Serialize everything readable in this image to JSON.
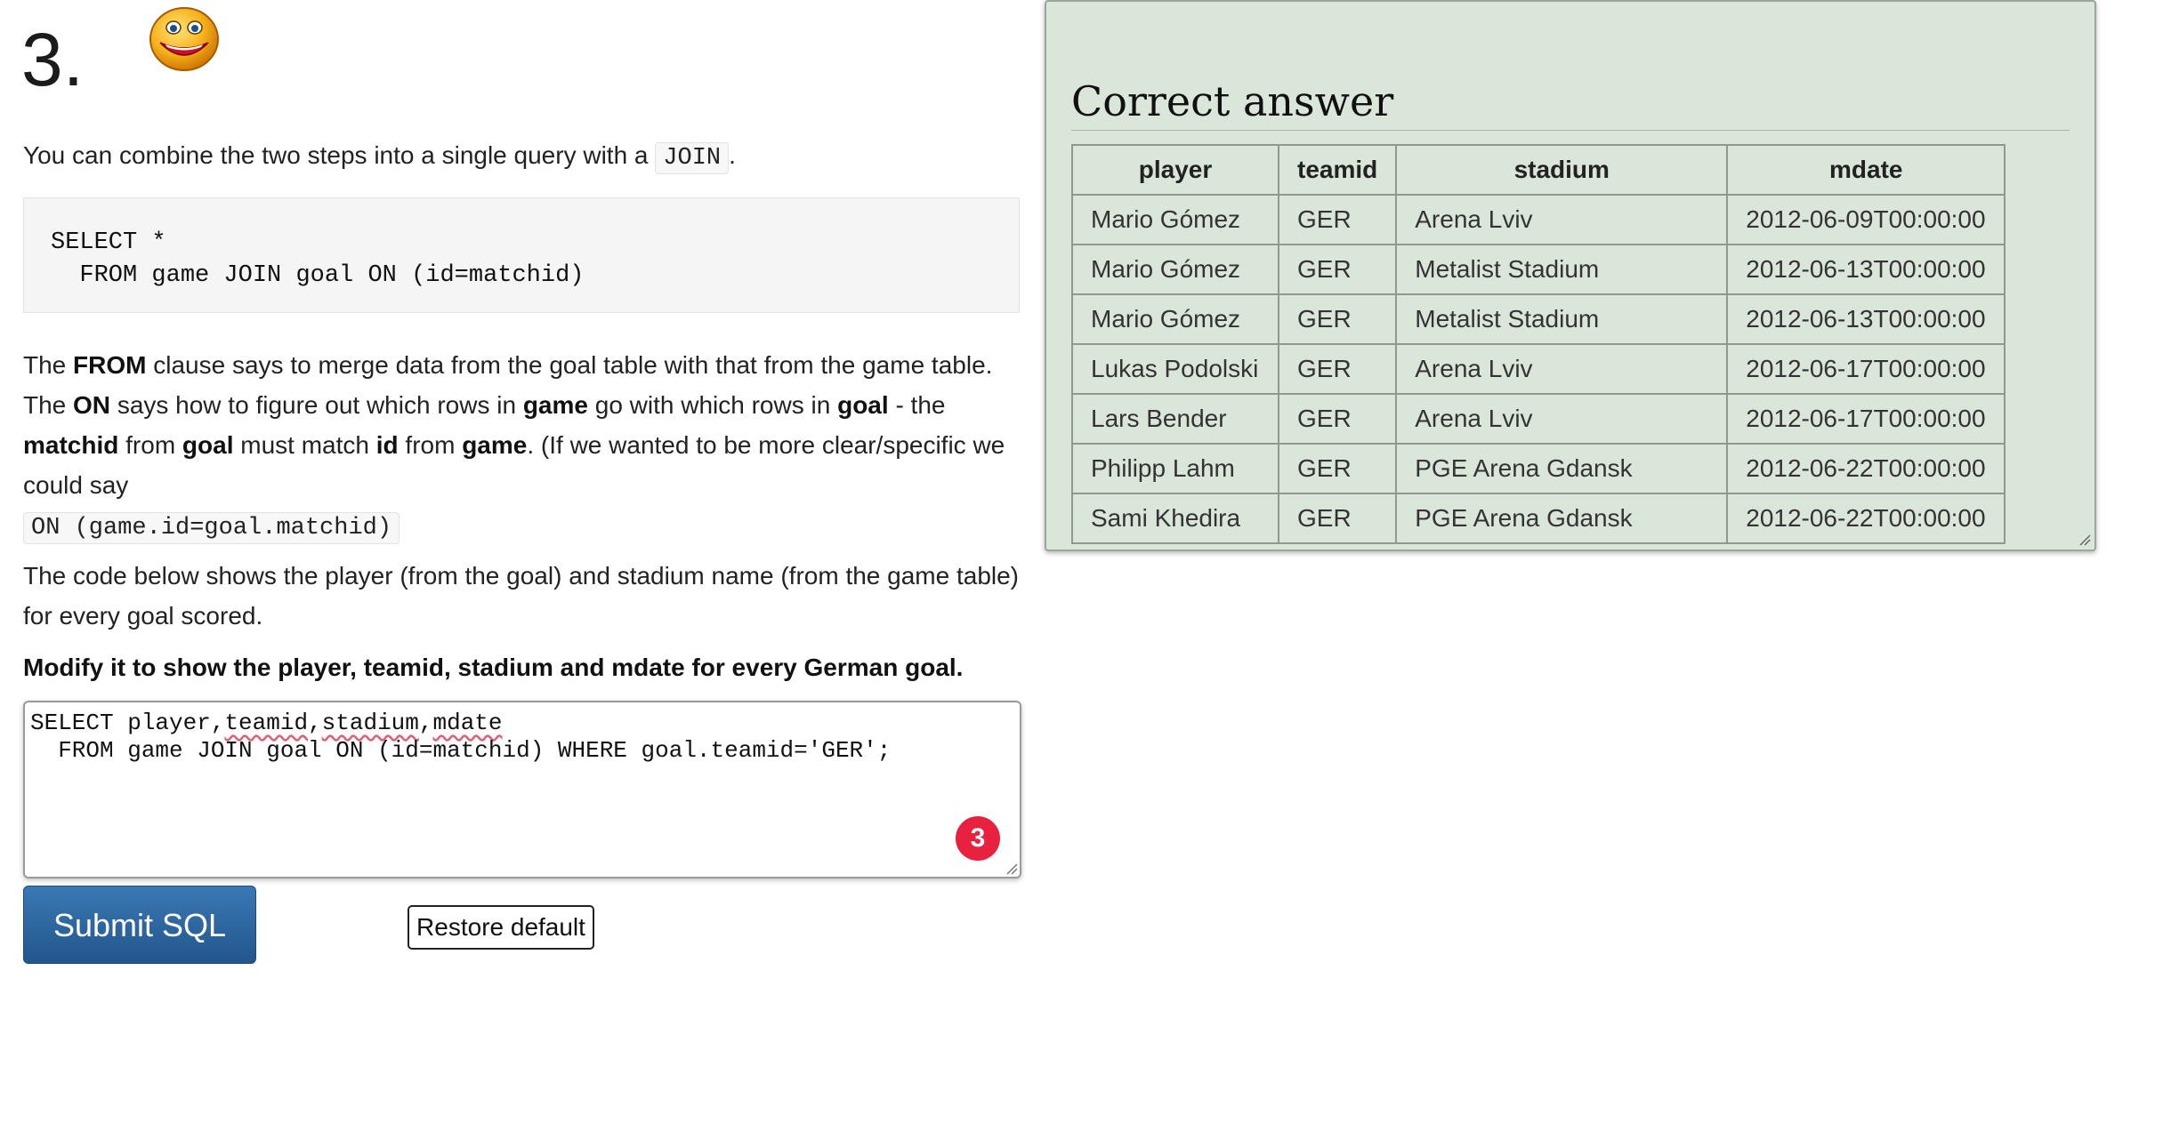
{
  "question": {
    "number": "3."
  },
  "intro": {
    "text": "You can combine the two steps into a single query with a",
    "code": "JOIN",
    "end": "."
  },
  "code_example": {
    "line1": "SELECT *",
    "line2": "  FROM game JOIN goal ON (id=matchid)"
  },
  "explanation": {
    "p1_a": "The",
    "p1_from": "FROM",
    "p1_b": "clause says to merge data from the goal table with that from the game table.",
    "p1_c": "The",
    "p1_on": "ON",
    "p1_d": "says how to figure out which rows in",
    "p1_game": "game",
    "p1_e": "go with which rows in",
    "p1_goal": "goal",
    "p1_f": "- the",
    "p1_matchid": "matchid",
    "p1_g": "from",
    "p1_goal2": "goal",
    "p1_h": "must match",
    "p1_id": "id",
    "p1_i": "from",
    "p1_game2": "game",
    "p1_j": ". (If we wanted to be more clear/specific we could say",
    "p1_code": "ON (game.id=goal.matchid)",
    "p2": "The code below shows the player (from the goal) and stadium name (from the game table) for every goal scored.",
    "task": "Modify it to show the player, teamid, stadium and mdate for every German goal."
  },
  "editor": {
    "l1_a": "SELECT player,",
    "l1_b": "teamid",
    "l1_c": ",",
    "l1_d": "stadium",
    "l1_e": ",",
    "l1_f": "mdate",
    "l2": "  FROM game JOIN goal ON (id=matchid) WHERE goal.teamid='GER';",
    "error_count": "3"
  },
  "buttons": {
    "submit": "Submit SQL",
    "restore": "Restore default"
  },
  "answer_panel": {
    "title": "Correct answer",
    "columns": [
      "player",
      "teamid",
      "stadium",
      "mdate"
    ],
    "rows": [
      [
        "Mario Gómez",
        "GER",
        "Arena Lviv",
        "2012-06-09T00:00:00"
      ],
      [
        "Mario Gómez",
        "GER",
        "Metalist Stadium",
        "2012-06-13T00:00:00"
      ],
      [
        "Mario Gómez",
        "GER",
        "Metalist Stadium",
        "2012-06-13T00:00:00"
      ],
      [
        "Lukas Podolski",
        "GER",
        "Arena Lviv",
        "2012-06-17T00:00:00"
      ],
      [
        "Lars Bender",
        "GER",
        "Arena Lviv",
        "2012-06-17T00:00:00"
      ],
      [
        "Philipp Lahm",
        "GER",
        "PGE Arena Gdansk",
        "2012-06-22T00:00:00"
      ],
      [
        "Sami Khedira",
        "GER",
        "PGE Arena Gdansk",
        "2012-06-22T00:00:00"
      ]
    ]
  },
  "icons": {
    "smiley": "grinning-face-icon",
    "error": "error-count-badge"
  },
  "colors": {
    "panel_bg": "#dbe6da",
    "submit_bg": "#2a63a0",
    "error_badge": "#e8213f"
  }
}
